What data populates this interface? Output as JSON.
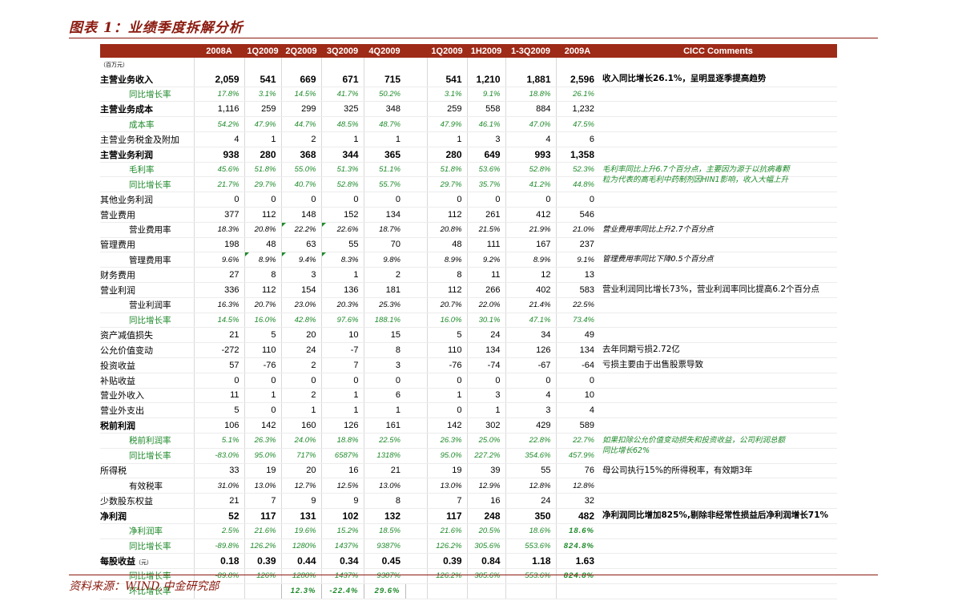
{
  "figure_title": "图表 1：业绩季度拆解分析",
  "source": "资料来源：WIND,中金研究部",
  "columns": [
    "",
    "2008A",
    "1Q2009",
    "2Q2009",
    "3Q2009",
    "4Q2009",
    "",
    "1Q2009",
    "1H2009",
    "1-3Q2009",
    "2009A",
    "CICC Comments"
  ],
  "unit_label": "（百万元）",
  "rows": [
    {
      "label": "主营业务收入",
      "style": "bold",
      "v": [
        "2,059",
        "541",
        "669",
        "671",
        "715",
        "541",
        "1,210",
        "1,881",
        "2,596"
      ],
      "comment": "收入同比增长26.1%，呈明显逐季提高趋势"
    },
    {
      "label": "同比增长率",
      "style": "green",
      "v": [
        "17.8%",
        "3.1%",
        "14.5%",
        "41.7%",
        "50.2%",
        "3.1%",
        "9.1%",
        "18.8%",
        "26.1%"
      ],
      "comment": ""
    },
    {
      "label": "主营业务成本",
      "style": "boldlabel",
      "v": [
        "1,116",
        "259",
        "299",
        "325",
        "348",
        "259",
        "558",
        "884",
        "1,232"
      ],
      "comment": ""
    },
    {
      "label": "成本率",
      "style": "green",
      "v": [
        "54.2%",
        "47.9%",
        "44.7%",
        "48.5%",
        "48.7%",
        "47.9%",
        "46.1%",
        "47.0%",
        "47.5%"
      ],
      "comment": ""
    },
    {
      "label": "主营业务税金及附加",
      "style": "plain",
      "v": [
        "4",
        "1",
        "2",
        "1",
        "1",
        "1",
        "3",
        "4",
        "6"
      ],
      "comment": ""
    },
    {
      "label": "主营业务利润",
      "style": "bold",
      "v": [
        "938",
        "280",
        "368",
        "344",
        "365",
        "280",
        "649",
        "993",
        "1,358"
      ],
      "comment": ""
    },
    {
      "label": "毛利率",
      "style": "green",
      "v": [
        "45.6%",
        "51.8%",
        "55.0%",
        "51.3%",
        "51.1%",
        "51.8%",
        "53.6%",
        "52.8%",
        "52.3%"
      ],
      "comment": "毛利率同比上升6.7个百分点，主要因为源于以抗病毒颗\n粒为代表的高毛利中药制剂因HIN1影响，收入大幅上升"
    },
    {
      "label": "同比增长率",
      "style": "green",
      "v": [
        "21.7%",
        "29.7%",
        "40.7%",
        "52.8%",
        "55.7%",
        "29.7%",
        "35.7%",
        "41.2%",
        "44.8%"
      ],
      "comment": ""
    },
    {
      "label": "其他业务利润",
      "style": "plain",
      "v": [
        "0",
        "0",
        "0",
        "0",
        "0",
        "0",
        "0",
        "0",
        "0"
      ],
      "comment": ""
    },
    {
      "label": "营业费用",
      "style": "plain",
      "v": [
        "377",
        "112",
        "148",
        "152",
        "134",
        "112",
        "261",
        "412",
        "546"
      ],
      "comment": ""
    },
    {
      "label": "营业费用率",
      "style": "sub-black",
      "v": [
        "18.3%",
        "20.8%",
        "22.2%",
        "22.6%",
        "18.7%",
        "20.8%",
        "21.5%",
        "21.9%",
        "21.0%"
      ],
      "comment": "营业费用率同比上升2.7个百分点"
    },
    {
      "label": "管理费用",
      "style": "plain",
      "v": [
        "198",
        "48",
        "63",
        "55",
        "70",
        "48",
        "111",
        "167",
        "237"
      ],
      "comment": ""
    },
    {
      "label": "管理费用率",
      "style": "sub-black",
      "v": [
        "9.6%",
        "8.9%",
        "9.4%",
        "8.3%",
        "9.8%",
        "8.9%",
        "9.2%",
        "8.9%",
        "9.1%"
      ],
      "comment": "管理费用率同比下降0.5个百分点"
    },
    {
      "label": "财务费用",
      "style": "plain",
      "v": [
        "27",
        "8",
        "3",
        "1",
        "2",
        "8",
        "11",
        "12",
        "13"
      ],
      "comment": ""
    },
    {
      "label": "营业利润",
      "style": "plain",
      "v": [
        "336",
        "112",
        "154",
        "136",
        "181",
        "112",
        "266",
        "402",
        "583"
      ],
      "comment": "营业利润同比增长73%，营业利润率同比提高6.2个百分点"
    },
    {
      "label": "营业利润率",
      "style": "sub-black",
      "v": [
        "16.3%",
        "20.7%",
        "23.0%",
        "20.3%",
        "25.3%",
        "20.7%",
        "22.0%",
        "21.4%",
        "22.5%"
      ],
      "comment": ""
    },
    {
      "label": "同比增长率",
      "style": "green",
      "v": [
        "14.5%",
        "16.0%",
        "42.8%",
        "97.6%",
        "188.1%",
        "16.0%",
        "30.1%",
        "47.1%",
        "73.4%"
      ],
      "comment": ""
    },
    {
      "label": "资产减值损失",
      "style": "plain",
      "v": [
        "21",
        "5",
        "20",
        "10",
        "15",
        "5",
        "24",
        "34",
        "49"
      ],
      "comment": ""
    },
    {
      "label": "公允价值变动",
      "style": "plain",
      "v": [
        "-272",
        "110",
        "24",
        "-7",
        "8",
        "110",
        "134",
        "126",
        "134"
      ],
      "comment": "去年同期亏损2.72亿"
    },
    {
      "label": "投资收益",
      "style": "plain",
      "v": [
        "57",
        "-76",
        "2",
        "7",
        "3",
        "-76",
        "-74",
        "-67",
        "-64"
      ],
      "comment": "亏损主要由于出售股票导致"
    },
    {
      "label": "补贴收益",
      "style": "plain",
      "v": [
        "0",
        "0",
        "0",
        "0",
        "0",
        "0",
        "0",
        "0",
        "0"
      ],
      "comment": ""
    },
    {
      "label": "营业外收入",
      "style": "plain",
      "v": [
        "11",
        "1",
        "2",
        "1",
        "6",
        "1",
        "3",
        "4",
        "10"
      ],
      "comment": ""
    },
    {
      "label": "营业外支出",
      "style": "plain",
      "v": [
        "5",
        "0",
        "1",
        "1",
        "1",
        "0",
        "1",
        "3",
        "4"
      ],
      "comment": ""
    },
    {
      "label": "税前利润",
      "style": "boldlabel",
      "v": [
        "106",
        "142",
        "160",
        "126",
        "161",
        "142",
        "302",
        "429",
        "589"
      ],
      "comment": ""
    },
    {
      "label": "税前利润率",
      "style": "green",
      "v": [
        "5.1%",
        "26.3%",
        "24.0%",
        "18.8%",
        "22.5%",
        "26.3%",
        "25.0%",
        "22.8%",
        "22.7%"
      ],
      "comment": "如果扣除公允价值变动损失和投资收益，公司利润总额\n同比增长62%"
    },
    {
      "label": "同比增长率",
      "style": "green",
      "v": [
        "-83.0%",
        "95.0%",
        "717%",
        "6587%",
        "1318%",
        "95.0%",
        "227.2%",
        "354.6%",
        "457.9%"
      ],
      "comment": ""
    },
    {
      "label": "所得税",
      "style": "plain",
      "v": [
        "33",
        "19",
        "20",
        "16",
        "21",
        "19",
        "39",
        "55",
        "76"
      ],
      "comment": "母公司执行15%的所得税率，有效期3年"
    },
    {
      "label": "有效税率",
      "style": "sub-black",
      "v": [
        "31.0%",
        "13.0%",
        "12.7%",
        "12.5%",
        "13.0%",
        "13.0%",
        "12.9%",
        "12.8%",
        "12.8%"
      ],
      "comment": ""
    },
    {
      "label": "少数股东权益",
      "style": "plain",
      "v": [
        "21",
        "7",
        "9",
        "9",
        "8",
        "7",
        "16",
        "24",
        "32"
      ],
      "comment": ""
    },
    {
      "label": "净利润",
      "style": "bold",
      "v": [
        "52",
        "117",
        "131",
        "102",
        "132",
        "117",
        "248",
        "350",
        "482"
      ],
      "comment": "净利润同比增加825%,剔除非经常性损益后净利润增长71%"
    },
    {
      "label": "净利润率",
      "style": "green",
      "v": [
        "2.5%",
        "21.6%",
        "19.6%",
        "15.2%",
        "18.5%",
        "21.6%",
        "20.5%",
        "18.6%",
        "18.6%"
      ],
      "comment": ""
    },
    {
      "label": "同比增长率",
      "style": "green",
      "v": [
        "-89.8%",
        "126.2%",
        "1280%",
        "1437%",
        "9387%",
        "126.2%",
        "305.6%",
        "553.6%",
        "824.8%"
      ],
      "comment": ""
    },
    {
      "label": "每股收益",
      "label_unit": "（元）",
      "style": "bold",
      "v": [
        "0.18",
        "0.39",
        "0.44",
        "0.34",
        "0.45",
        "0.39",
        "0.84",
        "1.18",
        "1.63"
      ],
      "comment": ""
    },
    {
      "label": "同比增长率",
      "style": "green",
      "v": [
        "-89.8%",
        "126%",
        "1280%",
        "1437%",
        "9387%",
        "126.2%",
        "305.6%",
        "553.6%",
        "824.8%"
      ],
      "comment": ""
    },
    {
      "label": "环比增长率",
      "style": "green",
      "v": [
        "",
        "",
        "12.3%",
        "-22.4%",
        "29.6%",
        "",
        "",
        "",
        ""
      ],
      "comment": ""
    }
  ],
  "colors": {
    "header_bg": "#9e2a18",
    "title": "#8b1a0f",
    "green": "#1e8a2a"
  }
}
